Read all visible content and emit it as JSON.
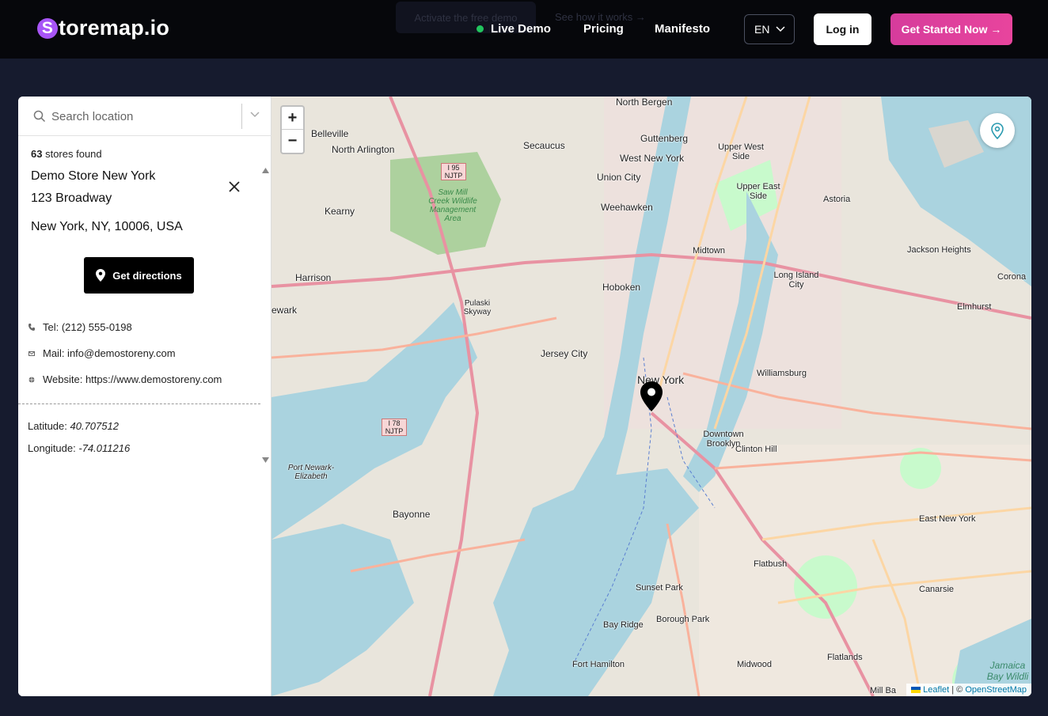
{
  "header": {
    "logo_letter": "S",
    "logo_text": "toremap.io",
    "ghost_button": "Activate the free demo",
    "ghost_link": "See how it works →",
    "nav": {
      "live_demo": "Live Demo",
      "pricing": "Pricing",
      "manifesto": "Manifesto"
    },
    "language": "EN",
    "login": "Log in",
    "cta": "Get Started Now →"
  },
  "sidebar": {
    "search_placeholder": "Search location",
    "stores_count": "63",
    "stores_found_label": "stores found",
    "store": {
      "name": "Demo Store New York",
      "address_line1": "123 Broadway",
      "address_line2": "New York, NY, 10006, USA",
      "directions_label": "Get directions",
      "tel": "Tel: (212) 555-0198",
      "mail": "Mail: info@demostoreny.com",
      "website": "Website: https://www.demostoreny.com",
      "latitude_label": "Latitude:",
      "latitude": "40.707512",
      "longitude_label": "Longitude:",
      "longitude": "-74.011216"
    }
  },
  "map": {
    "zoom_in": "+",
    "zoom_out": "−",
    "attribution_leaflet": "Leaflet",
    "attribution_sep": " | © ",
    "attribution_osm": "OpenStreetMap",
    "labels": {
      "north_bergen": "North Bergen",
      "secaucus": "Secaucus",
      "guttenberg": "Guttenberg",
      "upper_west": "Upper West Side",
      "belleville": "Belleville",
      "north_arlington": "North Arlington",
      "west_new_york": "West New York",
      "union_city": "Union City",
      "upper_east": "Upper East Side",
      "astoria": "Astoria",
      "kearny": "Kearny",
      "weehawken": "Weehawken",
      "jackson_heights": "Jackson Heights",
      "harrison": "Harrison",
      "midtown": "Midtown",
      "long_island_city": "Long Island City",
      "corona": "Corona",
      "hoboken": "Hoboken",
      "pulaski": "Pulaski Skyway",
      "elmhurst": "Elmhurst",
      "newark": "ewark",
      "jersey_city": "Jersey City",
      "williamsburg": "Williamsburg",
      "new_york": "New York",
      "downtown_brooklyn": "Downtown Brooklyn",
      "clinton_hill": "Clinton Hill",
      "port_newark": "Port Newark-Elizabeth",
      "bayonne": "Bayonne",
      "east_new_york": "East New York",
      "flatbush": "Flatbush",
      "canarsie": "Canarsie",
      "sunset_park": "Sunset Park",
      "borough_park": "Borough Park",
      "bay_ridge": "Bay Ridge",
      "flatlands": "Flatlands",
      "fort_hamilton": "Fort Hamilton",
      "midwood": "Midwood",
      "mill_basin": "Mill Ba",
      "saw_mill": "Saw Mill Creek Wildlife Management Area",
      "jamaica_bay": "Jamaica Bay Wildli",
      "i95": "I 95 NJTP",
      "i78": "I 78 NJTP"
    }
  },
  "colors": {
    "nav_bg": "#06070b",
    "page_bg": "#161b2e",
    "logo_accent": "#a855f7",
    "cta": "#e8449d",
    "live": "#22c55e"
  }
}
